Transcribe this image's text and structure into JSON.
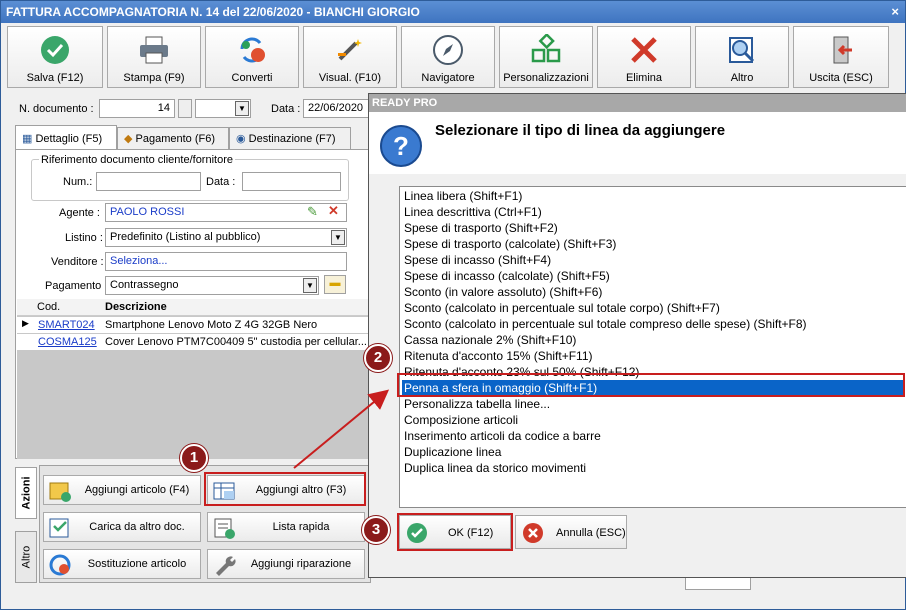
{
  "window": {
    "title": "FATTURA ACCOMPAGNATORIA N. 14 del 22/06/2020 - BIANCHI GIORGIO",
    "close": "×"
  },
  "toolbar": {
    "salva": "Salva (F12)",
    "stampa": "Stampa (F9)",
    "converti": "Converti",
    "visual": "Visual. (F10)",
    "navigatore": "Navigatore",
    "personalizzazioni": "Personalizzazioni",
    "elimina": "Elimina",
    "altro": "Altro",
    "uscita": "Uscita (ESC)"
  },
  "header": {
    "ndoc_label": "N. documento :",
    "ndoc_value": "14",
    "data_label": "Data :",
    "data_value": "22/06/2020"
  },
  "tabs": {
    "dettaglio": "Dettaglio (F5)",
    "pagamento": "Pagamento (F6)",
    "destinazione": "Destinazione (F7)"
  },
  "riferimento": {
    "title": "Riferimento documento cliente/fornitore",
    "num_label": "Num.:",
    "data_label": "Data :"
  },
  "form": {
    "agente_label": "Agente :",
    "agente_value": "PAOLO ROSSI",
    "listino_label": "Listino :",
    "listino_value": "Predefinito (Listino al pubblico)",
    "venditore_label": "Venditore :",
    "venditore_value": "Seleziona...",
    "pagamento_label": "Pagamento :",
    "pagamento_value": "Contrassegno"
  },
  "grid": {
    "col_cod": "Cod.",
    "col_desc": "Descrizione",
    "rows": [
      {
        "cod": "SMART024",
        "desc": "Smartphone Lenovo Moto Z 4G 32GB Nero"
      },
      {
        "cod": "COSMA125",
        "desc": "Cover Lenovo PTM7C00409 5\" custodia per cellular..."
      }
    ]
  },
  "side_tabs": {
    "azioni": "Azioni",
    "altro": "Altro"
  },
  "actions": {
    "aggiungi_articolo": "Aggiungi articolo (F4)",
    "aggiungi_altro": "Aggiungi altro (F3)",
    "carica": "Carica da altro doc.",
    "lista_rapida": "Lista rapida",
    "sostituzione": "Sostituzione articolo",
    "riparazione": "Aggiungi riparazione"
  },
  "dialog": {
    "title": "READY PRO",
    "question": "Selezionare il tipo di linea da aggiungere",
    "items": [
      "Linea libera (Shift+F1)",
      "Linea descrittiva (Ctrl+F1)",
      "Spese di trasporto (Shift+F2)",
      "Spese di trasporto (calcolate) (Shift+F3)",
      "Spese di incasso (Shift+F4)",
      "Spese di incasso (calcolate) (Shift+F5)",
      "Sconto (in valore assoluto) (Shift+F6)",
      "Sconto (calcolato in percentuale sul totale corpo) (Shift+F7)",
      "Sconto (calcolato in percentuale sul totale compreso delle spese) (Shift+F8)",
      "Cassa nazionale 2% (Shift+F10)",
      "Ritenuta d'acconto 15% (Shift+F11)",
      "Ritenuta d'acconto 23% sul 50% (Shift+F12)",
      "Penna a sfera in omaggio (Shift+F1)",
      "Personalizza tabella linee...",
      "Composizione articoli",
      "Inserimento articoli da codice a barre",
      "Duplicazione linea",
      "Duplica linea da storico movimenti"
    ],
    "selected_index": 12,
    "ok": "OK (F12)",
    "annulla": "Annulla (ESC)"
  },
  "callouts": {
    "b1": "1",
    "b2": "2",
    "b3": "3"
  },
  "colors": {
    "title_bar": "#4a80c8",
    "selection": "#0a64c8",
    "highlight": "#c81e1e",
    "badge": "#8b1a1a",
    "link": "#1a3cc8"
  }
}
